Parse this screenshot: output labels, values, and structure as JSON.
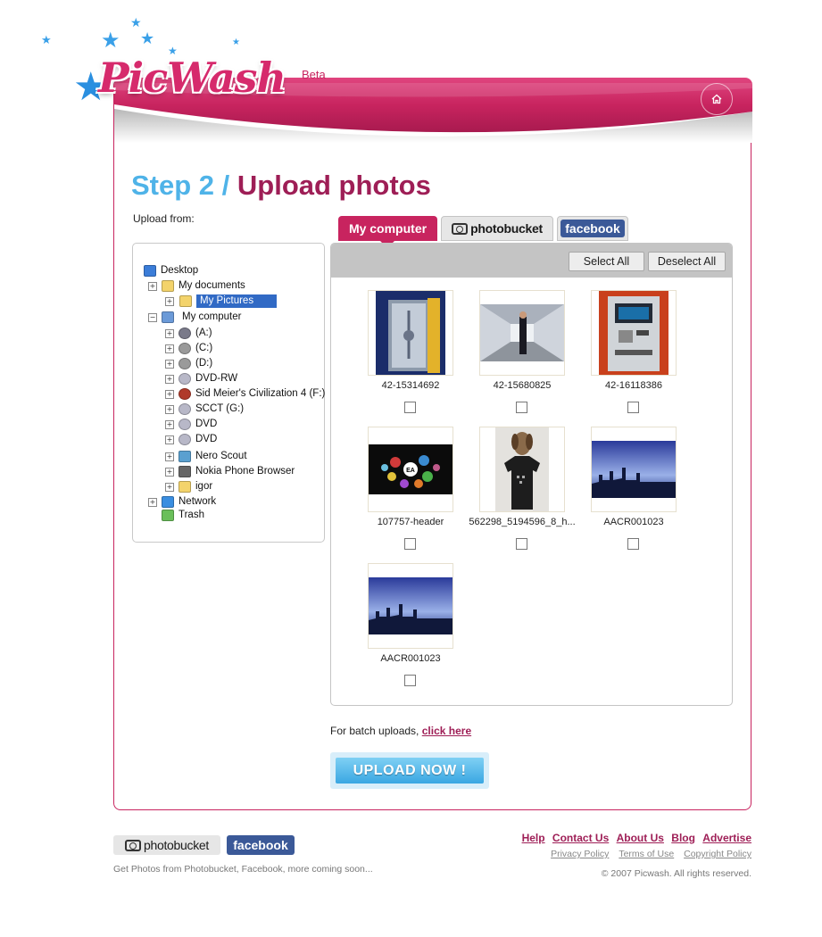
{
  "brand": {
    "logo_text": "PicWash",
    "beta_label": "Beta",
    "accent": "#c8245f",
    "blue": "#4fb3e8"
  },
  "header": {
    "home_icon": "home-icon"
  },
  "step": {
    "number": "Step 2 /",
    "title": "Upload photos"
  },
  "upload_from_label": "Upload from:",
  "tree": {
    "items": [
      {
        "label": "Desktop",
        "icon": "desktop-icon"
      },
      {
        "label": "My documents",
        "icon": "folder-icon"
      },
      {
        "label": "My Pictures",
        "icon": "folder-icon",
        "selected": true
      },
      {
        "label": "My computer",
        "icon": "computer-icon"
      },
      {
        "label": "(A:)",
        "icon": "floppy-drive-icon"
      },
      {
        "label": "(C:)",
        "icon": "hard-drive-icon"
      },
      {
        "label": "(D:)",
        "icon": "hard-drive-icon"
      },
      {
        "label": "DVD-RW",
        "icon": "cd-drive-icon"
      },
      {
        "label": "Sid Meier's Civilization 4 (F:)",
        "icon": "game-disc-icon"
      },
      {
        "label": "SCCT (G:)",
        "icon": "cd-drive-icon"
      },
      {
        "label": "DVD",
        "icon": "cd-drive-icon"
      },
      {
        "label": "DVD",
        "icon": "cd-drive-icon"
      },
      {
        "label": "Nero Scout",
        "icon": "network-folder-icon"
      },
      {
        "label": "Nokia Phone Browser",
        "icon": "phone-icon"
      },
      {
        "label": "igor",
        "icon": "folder-icon"
      },
      {
        "label": "Network",
        "icon": "network-icon"
      },
      {
        "label": "Trash",
        "icon": "trash-icon"
      }
    ]
  },
  "tabs": {
    "my_computer": "My computer",
    "photobucket": "photobucket",
    "facebook": "facebook"
  },
  "panel": {
    "select_all": "Select All",
    "deselect_all": "Deselect All"
  },
  "photos": [
    {
      "label": "42-15314692",
      "icon": "vault-image"
    },
    {
      "label": "42-15680825",
      "icon": "corridor-image"
    },
    {
      "label": "42-16118386",
      "icon": "atm-image"
    },
    {
      "label": "107757-header",
      "icon": "ea-header-image"
    },
    {
      "label": "562298_5194596_8_h...",
      "icon": "tshirt-image"
    },
    {
      "label": "AACR001023",
      "icon": "skyline-image"
    },
    {
      "label": "AACR001023",
      "icon": "skyline-image"
    }
  ],
  "batch": {
    "text": "For batch uploads,",
    "link": "click here"
  },
  "upload_button": "UPLOAD NOW !",
  "footer": {
    "photobucket": "photobucket",
    "facebook": "facebook",
    "note": "Get Photos from Photobucket, Facebook, more coming soon...",
    "links": [
      "Help",
      "Contact Us",
      "About Us",
      "Blog",
      "Advertise"
    ],
    "policies": [
      "Privacy Policy",
      "Terms of Use",
      "Copyright Policy"
    ],
    "copyright": "© 2007 Picwash. All rights reserved."
  }
}
